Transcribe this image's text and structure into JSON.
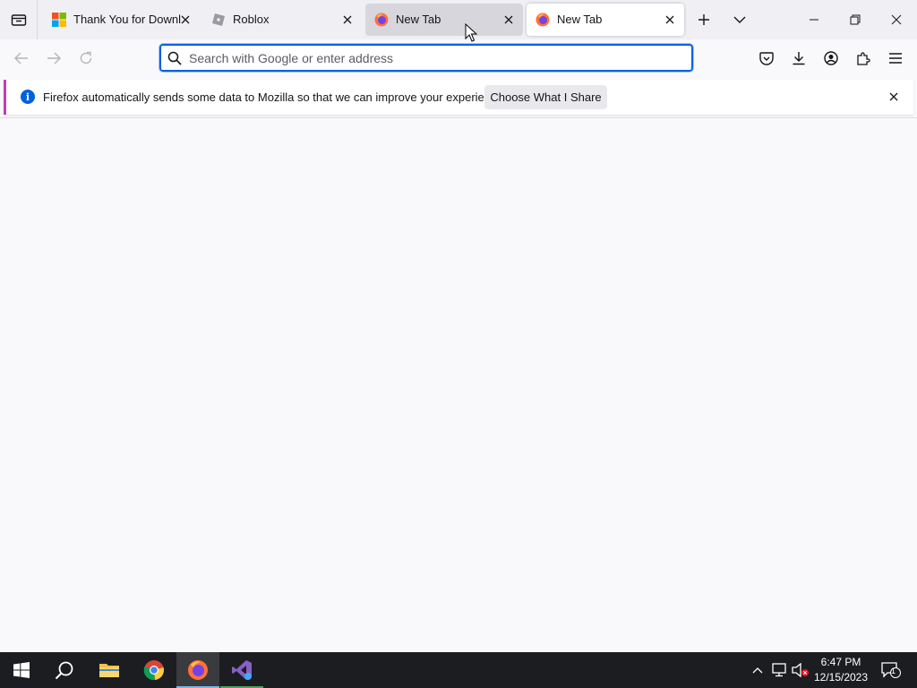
{
  "browser": {
    "tabs": [
      {
        "label": "Thank You for Downloa",
        "favicon": "microsoft-logo",
        "state": "normal"
      },
      {
        "label": "Roblox",
        "favicon": "roblox-logo",
        "state": "normal"
      },
      {
        "label": "New Tab",
        "favicon": "firefox-logo",
        "state": "hover"
      },
      {
        "label": "New Tab",
        "favicon": "firefox-logo",
        "state": "selected"
      }
    ],
    "urlbar": {
      "placeholder": "Search with Google or enter address",
      "value": ""
    },
    "notification": {
      "message": "Firefox automatically sends some data to Mozilla so that we can improve your experience.",
      "button_label": "Choose What I Share"
    }
  },
  "taskbar": {
    "apps": [
      "start-button",
      "search",
      "file-explorer",
      "chrome",
      "firefox",
      "visual-studio"
    ],
    "active_app": "firefox",
    "clock": {
      "time": "6:47 PM",
      "date": "12/15/2023"
    },
    "notification_count": "1"
  },
  "colors": {
    "accent": "#0061e0",
    "notification_bar": "#c340b5",
    "taskbar": "#1c1d21"
  }
}
